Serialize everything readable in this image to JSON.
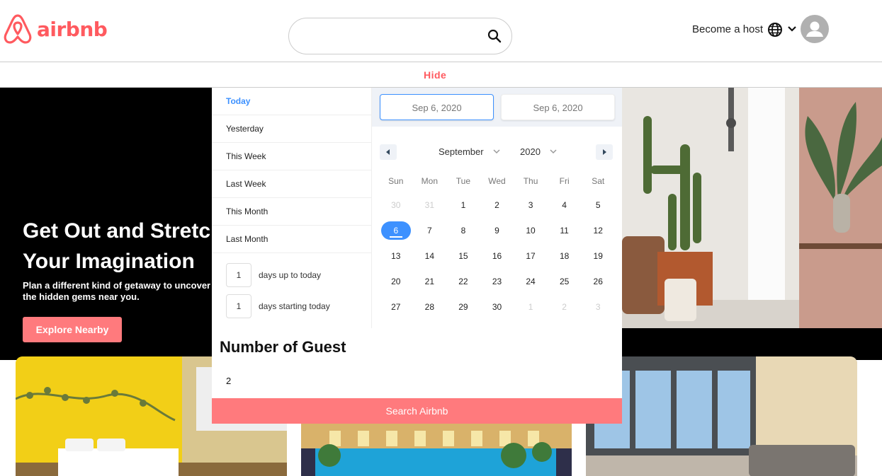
{
  "header": {
    "logo_text": "airbnb",
    "search_placeholder": "",
    "host_label": "Become a host"
  },
  "hide_label": "Hide",
  "hero": {
    "title": "Get Out and Stretch\nYour Imagination",
    "subtitle": "Plan a different kind of getaway to uncover the hidden gems near you.",
    "explore_button": "Explore Nearby"
  },
  "picker": {
    "ranges": [
      "Today",
      "Yesterday",
      "This Week",
      "Last Week",
      "This Month",
      "Last Month"
    ],
    "active_range": "Today",
    "days_up_to_today": {
      "value": "1",
      "label": "days up to today"
    },
    "days_starting_today": {
      "value": "1",
      "label": "days starting today"
    },
    "start_date": "Sep 6, 2020",
    "end_date": "Sep 6, 2020",
    "month": "September",
    "year": "2020",
    "weekdays": [
      "Sun",
      "Mon",
      "Tue",
      "Wed",
      "Thu",
      "Fri",
      "Sat"
    ],
    "days": [
      {
        "d": "30",
        "muted": true
      },
      {
        "d": "31",
        "muted": true
      },
      {
        "d": "1"
      },
      {
        "d": "2"
      },
      {
        "d": "3"
      },
      {
        "d": "4"
      },
      {
        "d": "5"
      },
      {
        "d": "6",
        "selected": true
      },
      {
        "d": "7"
      },
      {
        "d": "8"
      },
      {
        "d": "9"
      },
      {
        "d": "10"
      },
      {
        "d": "11"
      },
      {
        "d": "12"
      },
      {
        "d": "13"
      },
      {
        "d": "14"
      },
      {
        "d": "15"
      },
      {
        "d": "16"
      },
      {
        "d": "17"
      },
      {
        "d": "18"
      },
      {
        "d": "19"
      },
      {
        "d": "20"
      },
      {
        "d": "21"
      },
      {
        "d": "22"
      },
      {
        "d": "23"
      },
      {
        "d": "24"
      },
      {
        "d": "25"
      },
      {
        "d": "26"
      },
      {
        "d": "27"
      },
      {
        "d": "28"
      },
      {
        "d": "29"
      },
      {
        "d": "30"
      },
      {
        "d": "1",
        "muted": true
      },
      {
        "d": "2",
        "muted": true
      },
      {
        "d": "3",
        "muted": true
      }
    ]
  },
  "guests": {
    "title": "Number of Guest",
    "value": "2"
  },
  "search_button": "Search Airbnb",
  "colors": {
    "brand": "#ff5a5f",
    "button": "#ff7a7d",
    "accent": "#3d91ff"
  }
}
